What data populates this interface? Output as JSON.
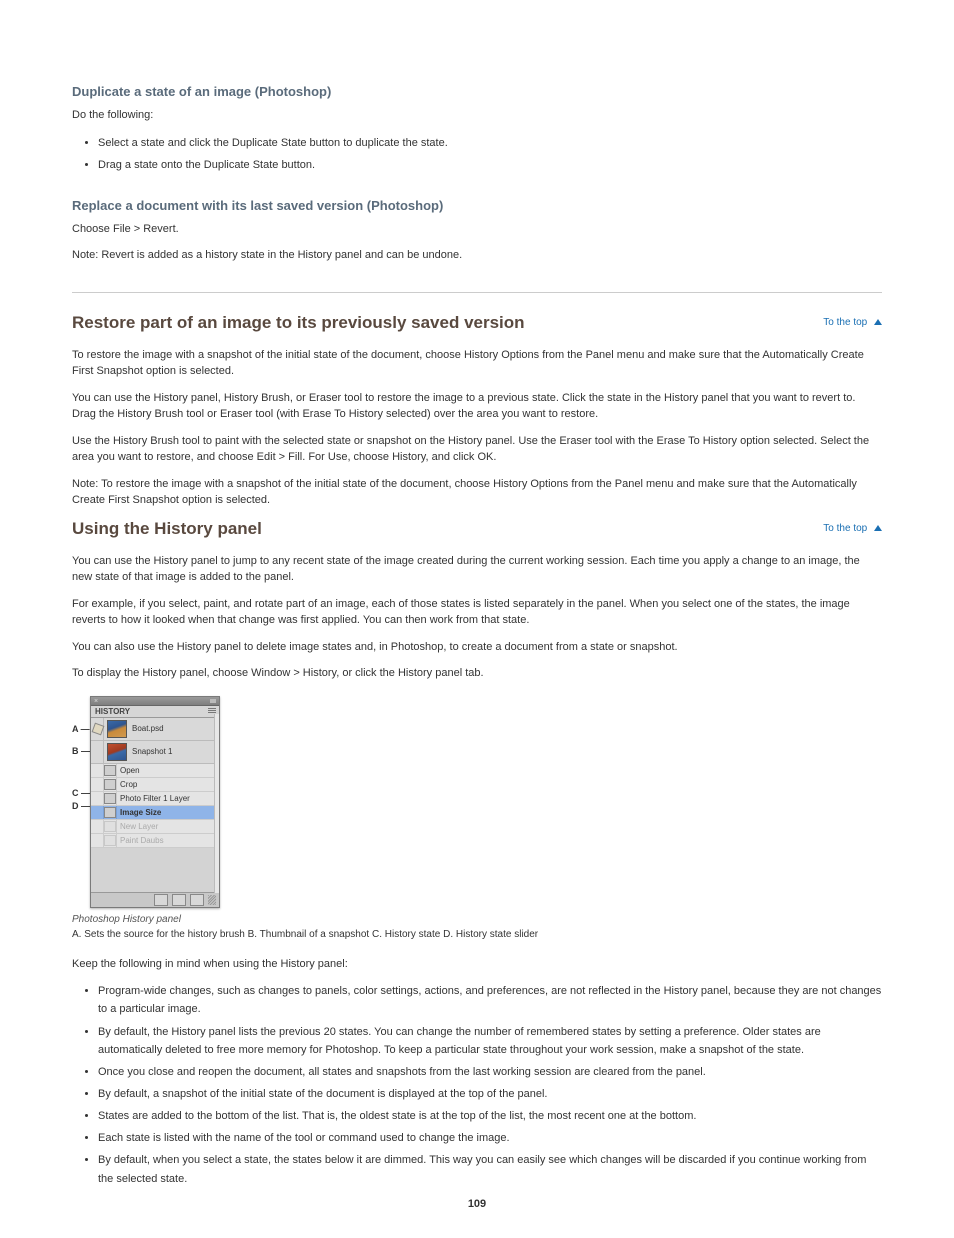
{
  "section1": {
    "head": "Duplicate a state of an image (Photoshop)",
    "p1": "Do the following:",
    "bullets": [
      "Select a state and click the Duplicate State button to duplicate the state.",
      "Drag a state onto the Duplicate State button."
    ],
    "head2": "Replace a document with its last saved version (Photoshop)",
    "p2": "Choose File > Revert.",
    "note": "Note: Revert is added as a history state in the History panel and can be undone."
  },
  "section2": {
    "toTop": "To the top",
    "title": "Restore part of an image to its previously saved version",
    "p1_a": "To restore the image with a snapshot of the initial state of the document, choose History Options from the Panel menu and make sure that the Automatically Create First Snapshot option is selected.",
    "p1_b": "You can use the History panel, History Brush, or Eraser tool to restore the image to a previous state. Click the state in the History panel that you want to revert to. Drag the History Brush tool or Eraser tool (with Erase To History selected) over the area you want to restore.",
    "p1_c": "Use the History Brush tool to paint with the selected state or snapshot on the History panel. Use the Eraser tool with the Erase To History option selected. Select the area you want to restore, and choose Edit > Fill. For Use, choose History, and click OK.",
    "p2": "Note: To restore the image with a snapshot of the initial state of the document, choose History Options from the Panel menu and make sure that the Automatically Create First Snapshot option is selected."
  },
  "section3": {
    "toTop": "To the top",
    "title": "Using the History panel",
    "p1": "You can use the History panel to jump to any recent state of the image created during the current working session. Each time you apply a change to an image, the new state of that image is added to the panel.",
    "p2": "For example, if you select, paint, and rotate part of an image, each of those states is listed separately in the panel. When you select one of the states, the image reverts to how it looked when that change was first applied. You can then work from that state.",
    "p3": "You can also use the History panel to delete image states and, in Photoshop, to create a document from a state or snapshot.",
    "p4": "To display the History panel, choose Window > History, or click the History panel tab."
  },
  "panel": {
    "tab": "HISTORY",
    "snap1": "Boat.psd",
    "snap2": "Snapshot 1",
    "h1": "Open",
    "h2": "Crop",
    "h3": "Photo Filter 1 Layer",
    "h4": "Image Size",
    "h5": "New Layer",
    "h6": "Paint Daubs",
    "caption": "Photoshop History panel",
    "labels": "A. Sets the source for the history brush  B. Thumbnail of a snapshot  C. History state  D. History state slider"
  },
  "section4": {
    "p1": "Keep the following in mind when using the History panel:",
    "bullets": [
      "Program-wide changes, such as changes to panels, color settings, actions, and preferences, are not reflected in the History panel, because they are not changes to a particular image.",
      "By default, the History panel lists the previous 20 states. You can change the number of remembered states by setting a preference. Older states are automatically deleted to free more memory for Photoshop. To keep a particular state throughout your work session, make a snapshot of the state.",
      "Once you close and reopen the document, all states and snapshots from the last working session are cleared from the panel.",
      "By default, a snapshot of the initial state of the document is displayed at the top of the panel.",
      "States are added to the bottom of the list. That is, the oldest state is at the top of the list, the most recent one at the bottom.",
      "Each state is listed with the name of the tool or command used to change the image.",
      "By default, when you select a state, the states below it are dimmed. This way you can easily see which changes will be discarded if you continue working from the selected state."
    ]
  },
  "pageNumber": "109"
}
